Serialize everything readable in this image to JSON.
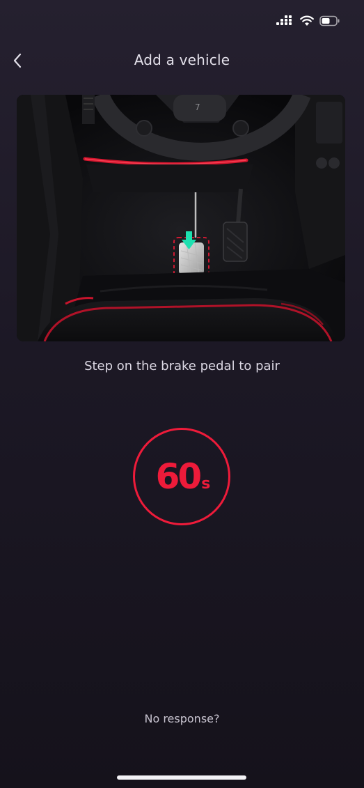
{
  "status_bar": {
    "signal_icon": "cellular-signal-icon",
    "wifi_icon": "wifi-icon",
    "battery_icon": "battery-icon",
    "battery_level": 0.55
  },
  "nav": {
    "back_icon": "chevron-left-icon",
    "title": "Add a vehicle"
  },
  "illustration": {
    "arrow_icon": "down-arrow-icon",
    "accent_color": "#1ee0b0"
  },
  "instruction": "Step on the brake pedal to pair",
  "countdown": {
    "value": "60",
    "unit": "s",
    "color": "#ee1b3a"
  },
  "no_response_link": "No response?"
}
